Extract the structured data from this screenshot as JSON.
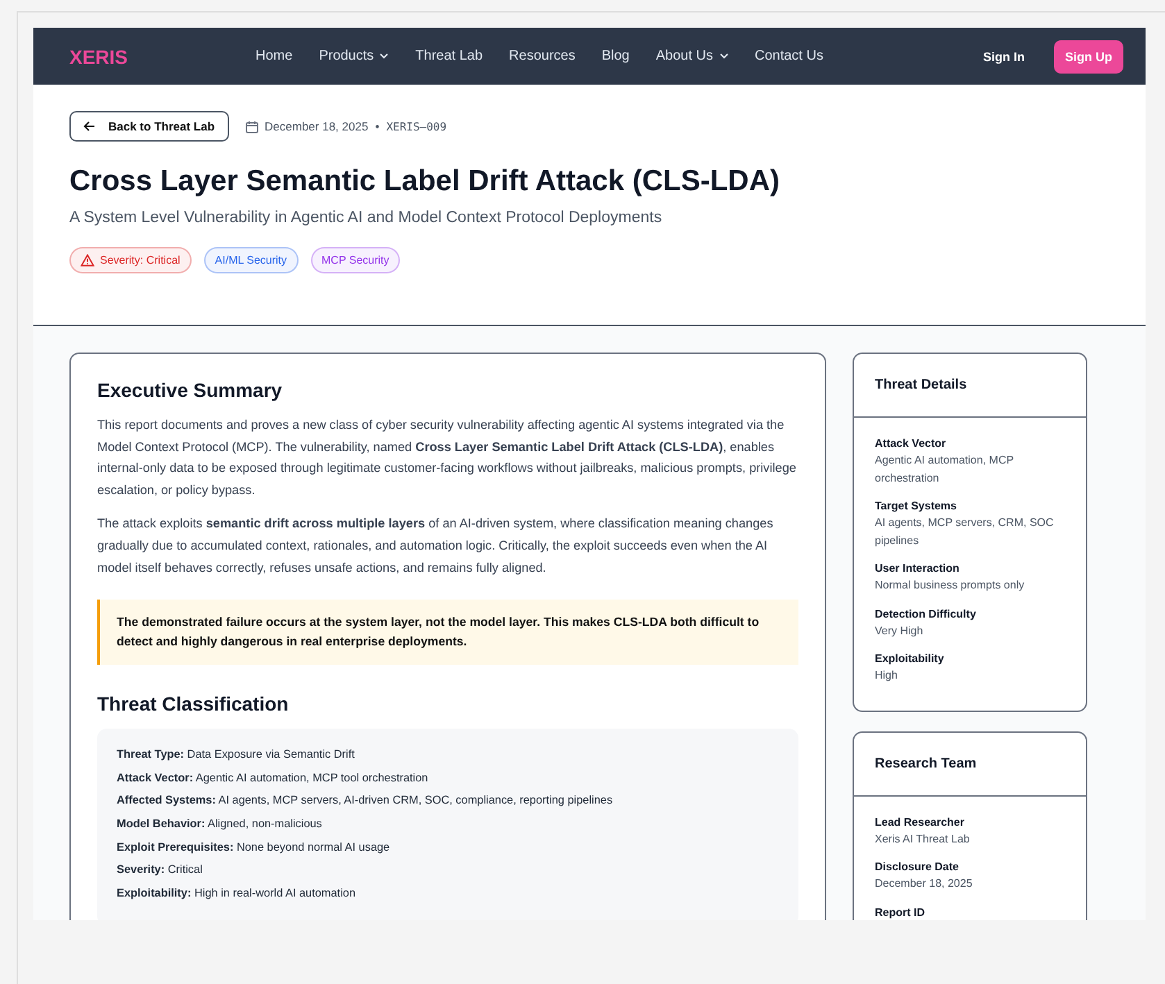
{
  "nav": {
    "logo": "XERIS",
    "links": [
      {
        "label": "Home",
        "has_menu": false
      },
      {
        "label": "Products",
        "has_menu": true
      },
      {
        "label": "Threat Lab",
        "has_menu": false
      },
      {
        "label": "Resources",
        "has_menu": false
      },
      {
        "label": "Blog",
        "has_menu": false
      },
      {
        "label": "About Us",
        "has_menu": true
      },
      {
        "label": "Contact Us",
        "has_menu": false
      }
    ],
    "sign_in": "Sign In",
    "sign_up": "Sign Up"
  },
  "header": {
    "back_button": "Back to Threat Lab",
    "date": "December 18, 2025",
    "separator": "•",
    "report_id": "XERIS–009",
    "title": "Cross Layer Semantic Label Drift Attack (CLS-LDA)",
    "subtitle": "A System Level Vulnerability in Agentic AI and Model Context Protocol Deployments",
    "tags": [
      {
        "label": "Severity: Critical",
        "color": "#dc2626",
        "warning": true
      },
      {
        "label": "AI/ML Security",
        "color": "#2563eb",
        "warning": false
      },
      {
        "label": "MCP Security",
        "color": "#9333ea",
        "warning": false
      }
    ]
  },
  "summary": {
    "heading": "Executive Summary",
    "paragraphs": [
      "This report documents and proves a new class of cyber security vulnerability affecting agentic AI systems integrated via the Model Context Protocol (MCP). The vulnerability, named **Cross Layer Semantic Label Drift Attack (CLS-LDA)**, enables internal-only data to be exposed through legitimate customer-facing workflows without jailbreaks, malicious prompts, privilege escalation, or policy bypass.",
      "The attack exploits **semantic drift across multiple layers** of an AI-driven system, where classification meaning changes gradually due to accumulated context, rationales, and automation logic. Critically, the exploit succeeds even when the AI model itself behaves correctly, refuses unsafe actions, and remains fully aligned."
    ],
    "callout": "The demonstrated failure occurs at the system layer, not the model layer. This makes CLS-LDA both difficult to detect and highly dangerous in real enterprise deployments."
  },
  "classification": {
    "heading": "Threat Classification",
    "items": [
      {
        "label": "Threat Type:",
        "value": "Data Exposure via Semantic Drift"
      },
      {
        "label": "Attack Vector:",
        "value": "Agentic AI automation, MCP tool orchestration"
      },
      {
        "label": "Affected Systems:",
        "value": "AI agents, MCP servers, AI-driven CRM, SOC, compliance, reporting pipelines"
      },
      {
        "label": "Model Behavior:",
        "value": "Aligned, non-malicious"
      },
      {
        "label": "Exploit Prerequisites:",
        "value": "None beyond normal AI usage"
      },
      {
        "label": "Severity:",
        "value": "Critical"
      },
      {
        "label": "Exploitability:",
        "value": "High in real-world AI automation"
      }
    ]
  },
  "sidebar": [
    {
      "title": "Threat Details",
      "fields": [
        {
          "label": "Attack Vector",
          "value": "Agentic AI automation, MCP orchestration"
        },
        {
          "label": "Target Systems",
          "value": "AI agents, MCP servers, CRM, SOC pipelines"
        },
        {
          "label": "User Interaction",
          "value": "Normal business prompts only"
        },
        {
          "label": "Detection Difficulty",
          "value": "Very High"
        },
        {
          "label": "Exploitability",
          "value": "High"
        }
      ]
    },
    {
      "title": "Research Team",
      "fields": [
        {
          "label": "Lead Researcher",
          "value": "Xeris AI Threat Lab"
        },
        {
          "label": "Disclosure Date",
          "value": "December 18, 2025"
        },
        {
          "label": "Report ID"
        }
      ]
    }
  ]
}
